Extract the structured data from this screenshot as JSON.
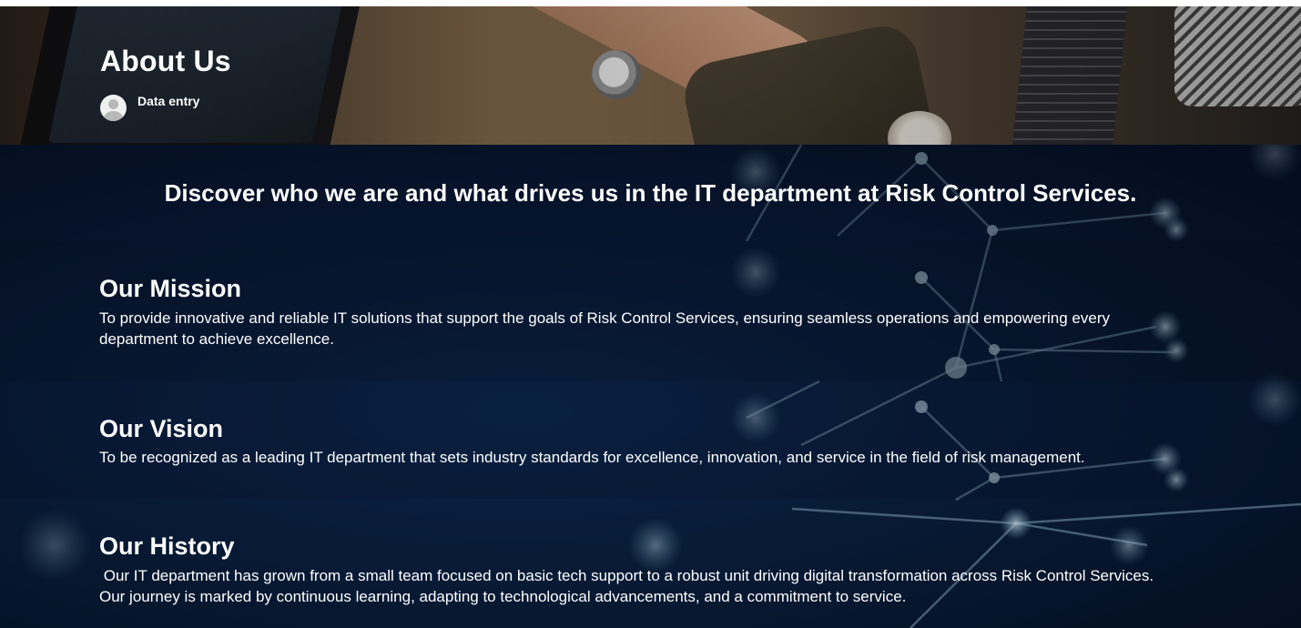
{
  "hero": {
    "title": "About Us",
    "author": "Data entry"
  },
  "tagline": "Discover who we are and what drives us in the IT department at Risk Control Services.",
  "sections": [
    {
      "title": "Our Mission",
      "text": "To provide innovative and reliable IT solutions that support the goals of Risk Control Services, ensuring seamless operations and empowering every department to achieve excellence."
    },
    {
      "title": "Our Vision",
      "text": "To be recognized as a leading IT department that sets industry standards for excellence, innovation, and service in the field of risk management."
    },
    {
      "title": "Our History",
      "text": " Our IT department has grown from a small team focused on basic tech support to a robust unit driving digital transformation across Risk Control Services. Our journey is marked by continuous learning, adapting to technological advancements, and a commitment to service."
    }
  ],
  "colors": {
    "text": "#ffffff",
    "background_dark": "#081a34",
    "accent_network": "#9fc4d6"
  }
}
